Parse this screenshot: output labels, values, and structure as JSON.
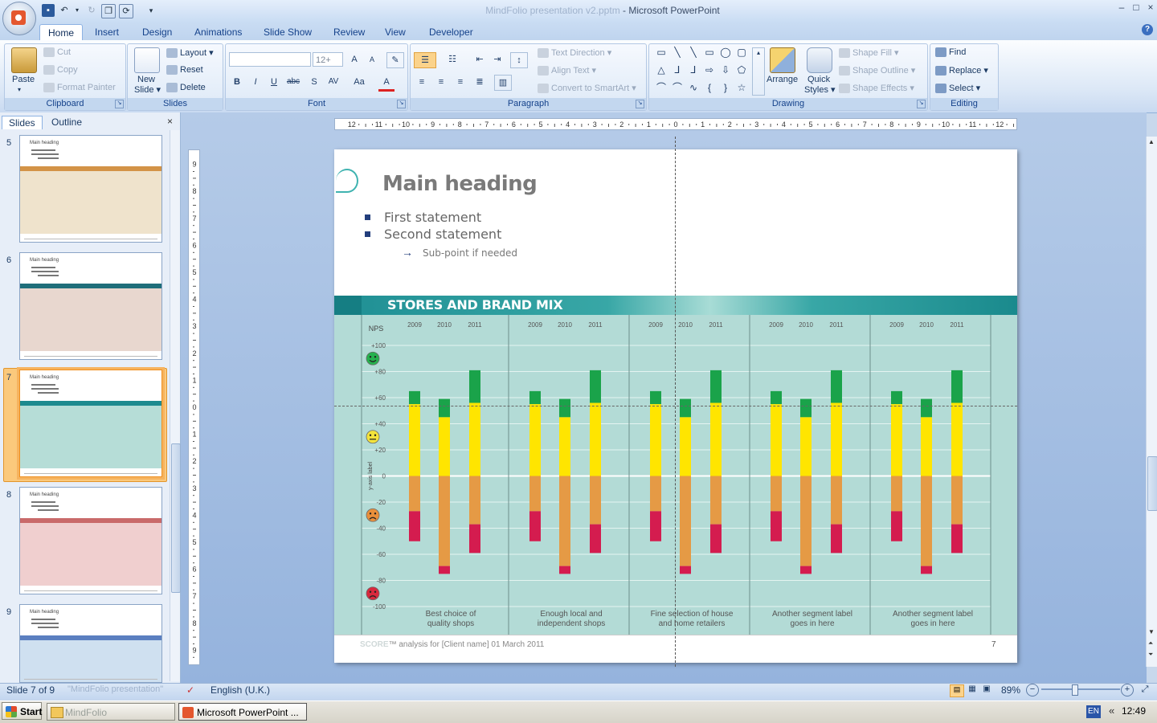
{
  "window": {
    "title_faded": "MindFolio presentation v2.pptm",
    "title_app": " - Microsoft PowerPoint",
    "controls": [
      "–",
      "□",
      "×"
    ]
  },
  "tabs": [
    "Home",
    "Insert",
    "Design",
    "Animations",
    "Slide Show",
    "Review",
    "View",
    "Developer"
  ],
  "ribbon": {
    "clipboard": {
      "label": "Clipboard",
      "paste": "Paste",
      "cut": "Cut",
      "copy": "Copy",
      "format_painter": "Format Painter"
    },
    "slides": {
      "label": "Slides",
      "new_slide_1": "New",
      "new_slide_2": "Slide",
      "layout": "Layout",
      "reset": "Reset",
      "delete": "Delete"
    },
    "font": {
      "label": "Font",
      "font_name": "",
      "font_size": "12+",
      "bold": "B",
      "italic": "I",
      "underline": "U",
      "strike": "abc",
      "shadow": "S",
      "spacing": "AV",
      "case": "Aa",
      "color": "A"
    },
    "paragraph": {
      "label": "Paragraph",
      "text_direction": "Text Direction",
      "align_text": "Align Text",
      "convert_smartart": "Convert to SmartArt"
    },
    "drawing": {
      "label": "Drawing",
      "arrange": "Arrange",
      "quick_styles_1": "Quick",
      "quick_styles_2": "Styles",
      "shape_fill": "Shape Fill",
      "shape_outline": "Shape Outline",
      "shape_effects": "Shape Effects"
    },
    "editing": {
      "label": "Editing",
      "find": "Find",
      "replace": "Replace",
      "select": "Select"
    }
  },
  "panel": {
    "tab_slides": "Slides",
    "tab_outline": "Outline",
    "close": "×",
    "thumbnails": [
      {
        "num": "5",
        "heading": "Main heading",
        "band": "#d39347",
        "body": "#efe3cc",
        "selected": false
      },
      {
        "num": "6",
        "heading": "Main heading",
        "band": "#1f6e7a",
        "body": "#e8d7cf",
        "selected": false
      },
      {
        "num": "7",
        "heading": "Main heading",
        "band": "#1d8a8f",
        "body": "#b6ddd7",
        "selected": true
      },
      {
        "num": "8",
        "heading": "Main heading",
        "band": "#c96a6a",
        "body": "#f0cfcf",
        "selected": false
      },
      {
        "num": "9",
        "heading": "Main heading",
        "band": "#5b7fc0",
        "body": "#cfe0f0",
        "selected": false
      }
    ]
  },
  "slide": {
    "heading": "Main heading",
    "bullet1": "First statement",
    "bullet2": "Second statement",
    "subpoint": "Sub-point if needed",
    "subpoint_arrow": "→",
    "band_title": "STORES AND BRAND MIX",
    "footer_faded": "SCORE",
    "footer_text": "™ analysis for [Client name] 01 March 2011",
    "page_number": "7",
    "colors": {
      "band": "#1f8f94",
      "chart_bg": "#b3dbd6",
      "green": "#1aa34a",
      "yellow": "#ffe500",
      "orange": "#e59a45",
      "red": "#d41c4f"
    }
  },
  "chart_data": {
    "type": "bar",
    "title": "STORES AND BRAND MIX",
    "ylabel": "y-axis label",
    "ytitle": "NPS",
    "ylim": [
      -100,
      100
    ],
    "yticks": [
      "+100",
      "+80",
      "+60",
      "+40",
      "+20",
      "0",
      "-20",
      "-40",
      "-60",
      "-80",
      "-100"
    ],
    "smileys": [
      {
        "level": 90,
        "mood": "happy",
        "color": "#25b14e"
      },
      {
        "level": 30,
        "mood": "neutral",
        "color": "#f3e33b"
      },
      {
        "level": -30,
        "mood": "sad",
        "color": "#e98f3b"
      },
      {
        "level": -90,
        "mood": "very sad",
        "color": "#d8293e"
      }
    ],
    "years": [
      "2009",
      "2010",
      "2011"
    ],
    "categories": [
      {
        "label1": "Best choice of",
        "label2": "quality shops"
      },
      {
        "label1": "Enough local and",
        "label2": "independent shops"
      },
      {
        "label1": "Fine selection of house",
        "label2": "and home retailers"
      },
      {
        "label1": "Another segment label",
        "label2": "goes in here"
      },
      {
        "label1": "Another segment label",
        "label2": "goes in here"
      }
    ],
    "stacks": {
      "2009": {
        "green": [
          55,
          65
        ],
        "yellow": [
          0,
          55
        ],
        "orange": [
          -27,
          0
        ],
        "red": [
          -50,
          -27
        ]
      },
      "2010": {
        "green": [
          45,
          59
        ],
        "yellow": [
          0,
          45
        ],
        "orange": [
          -69,
          0
        ],
        "red": [
          -75,
          -69
        ]
      },
      "2011": {
        "green": [
          56,
          81
        ],
        "yellow": [
          0,
          56
        ],
        "orange": [
          -37,
          0
        ],
        "red": [
          -59,
          -37
        ]
      }
    }
  },
  "status": {
    "slide_of": "Slide 7 of 9",
    "theme": "\"MindFolio presentation\"",
    "language": "English (U.K.)",
    "zoom": "89%"
  },
  "taskbar": {
    "start": "Start",
    "folder": "MindFolio",
    "ppt": "Microsoft PowerPoint ...",
    "lang": "EN",
    "chevron": "«",
    "clock": "12:49"
  }
}
